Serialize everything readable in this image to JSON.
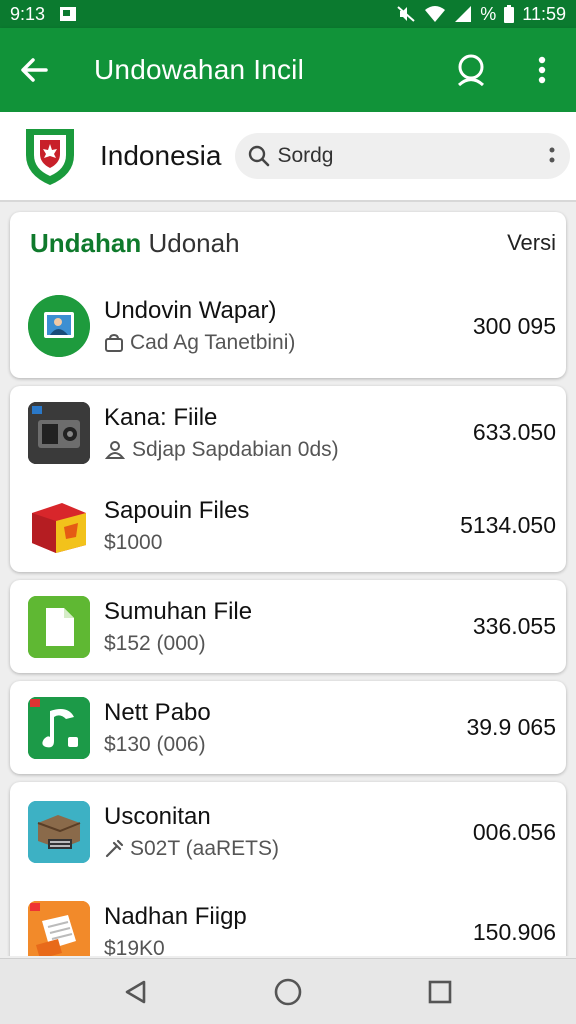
{
  "status_bar": {
    "time": "9:13",
    "battery_percent": "%",
    "clock": "11:59"
  },
  "app_bar": {
    "title": "Undowahan Incil"
  },
  "header": {
    "country": "Indonesia",
    "search_placeholder": "Sordg"
  },
  "section": {
    "title_green": "Undahan",
    "title_grey": "Udonah",
    "column_label": "Versi"
  },
  "items": [
    {
      "name": "Undovin Wapar)",
      "subtitle": "Cad Ag Tanetbini)",
      "value": "300 095",
      "icon": "photo-app-icon",
      "sub_icon": "bag-icon"
    },
    {
      "name": "Kana: Fiile",
      "subtitle": "Sdjap Sapdabian 0ds)",
      "value": "633.050",
      "icon": "machine-app-icon",
      "sub_icon": "people-icon"
    },
    {
      "name": "Sapouin Files",
      "subtitle": "$1000",
      "value": "5134.050",
      "icon": "box-app-icon",
      "sub_icon": ""
    },
    {
      "name": "Sumuhan File",
      "subtitle": "$152 (000)",
      "value": "336.055",
      "icon": "document-app-icon",
      "sub_icon": ""
    },
    {
      "name": "Nett Pabo",
      "subtitle": "$130 (006)",
      "value": "39.9 065",
      "icon": "music-app-icon",
      "sub_icon": ""
    },
    {
      "name": "Usconitan",
      "subtitle": "S02T (aaRETS)",
      "value": "006.056",
      "icon": "printer-app-icon",
      "sub_icon": "tools-icon"
    },
    {
      "name": "Nadhan Fiigp",
      "subtitle": "$19K0",
      "value": "150.906",
      "icon": "folder-app-icon",
      "sub_icon": ""
    }
  ],
  "colors": {
    "status_bar": "#0b7a2f",
    "app_bar": "#119339",
    "accent_green": "#0f7a2c"
  }
}
